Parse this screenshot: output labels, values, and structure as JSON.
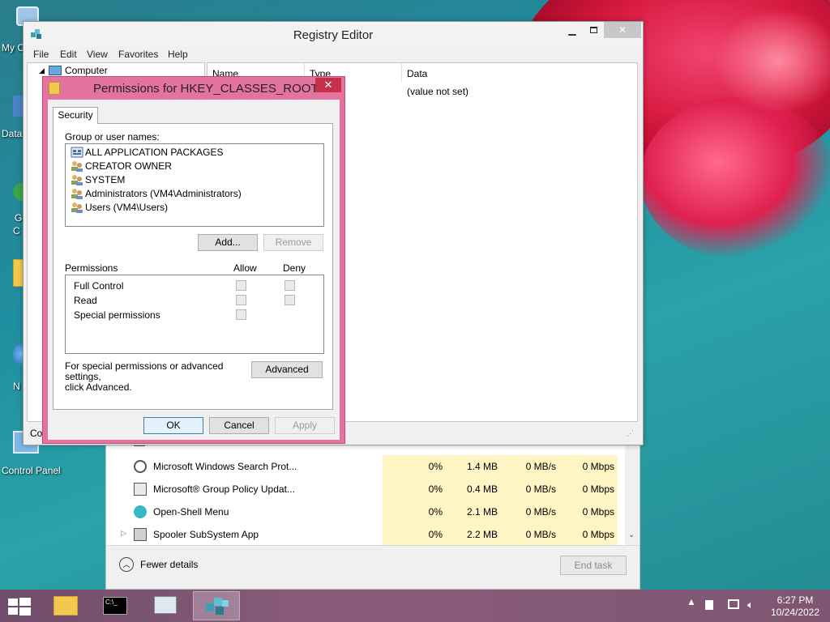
{
  "desktop": {
    "icons": [
      {
        "label": "My C"
      },
      {
        "label": "Data"
      },
      {
        "label": "G"
      },
      {
        "label": "C"
      },
      {
        "label": "N"
      },
      {
        "label": "Control Panel"
      }
    ]
  },
  "registry_editor": {
    "title": "Registry Editor",
    "menu": [
      "File",
      "Edit",
      "View",
      "Favorites",
      "Help"
    ],
    "tree_root": "Computer",
    "columns": [
      "Name",
      "Type",
      "Data"
    ],
    "rows": [
      {
        "data": "(value not set)"
      }
    ],
    "status_text": "Co"
  },
  "permissions_dialog": {
    "title": "Permissions for HKEY_CLASSES_ROOT",
    "close_glyph": "✕",
    "tab": "Security",
    "group_label": "Group or user names:",
    "users": [
      "ALL APPLICATION PACKAGES",
      "CREATOR OWNER",
      "SYSTEM",
      "Administrators (VM4\\Administrators)",
      "Users (VM4\\Users)"
    ],
    "add_label": "Add...",
    "remove_label": "Remove",
    "permissions_label": "Permissions",
    "allow_label": "Allow",
    "deny_label": "Deny",
    "permissions": [
      "Full Control",
      "Read",
      "Special permissions"
    ],
    "advanced_note_1": "For special permissions or advanced settings,",
    "advanced_note_2": "click Advanced.",
    "advanced_label": "Advanced",
    "ok_label": "OK",
    "cancel_label": "Cancel",
    "apply_label": "Apply"
  },
  "task_manager": {
    "processes": [
      {
        "name": "Microsoft Windows Search Prot...",
        "cpu": "0%",
        "memory": "1.4 MB",
        "disk": "0 MB/s",
        "network": "0 Mbps",
        "expandable": false
      },
      {
        "name": "Microsoft® Group Policy Updat...",
        "cpu": "0%",
        "memory": "0.4 MB",
        "disk": "0 MB/s",
        "network": "0 Mbps",
        "expandable": false
      },
      {
        "name": "Open-Shell Menu",
        "cpu": "0%",
        "memory": "2.1 MB",
        "disk": "0 MB/s",
        "network": "0 Mbps",
        "expandable": false
      },
      {
        "name": "Spooler SubSystem App",
        "cpu": "0%",
        "memory": "2.2 MB",
        "disk": "0 MB/s",
        "network": "0 Mbps",
        "expandable": true
      }
    ],
    "fewer_details": "Fewer details",
    "end_task": "End task"
  },
  "taskbar": {
    "time": "6:27 PM",
    "date": "10/24/2022",
    "tray_arrow": "▲"
  },
  "colors": {
    "dialog_frame": "#e5739f",
    "taskbar": "#7e5672",
    "memory_column_highlight": "#fff4c4"
  }
}
